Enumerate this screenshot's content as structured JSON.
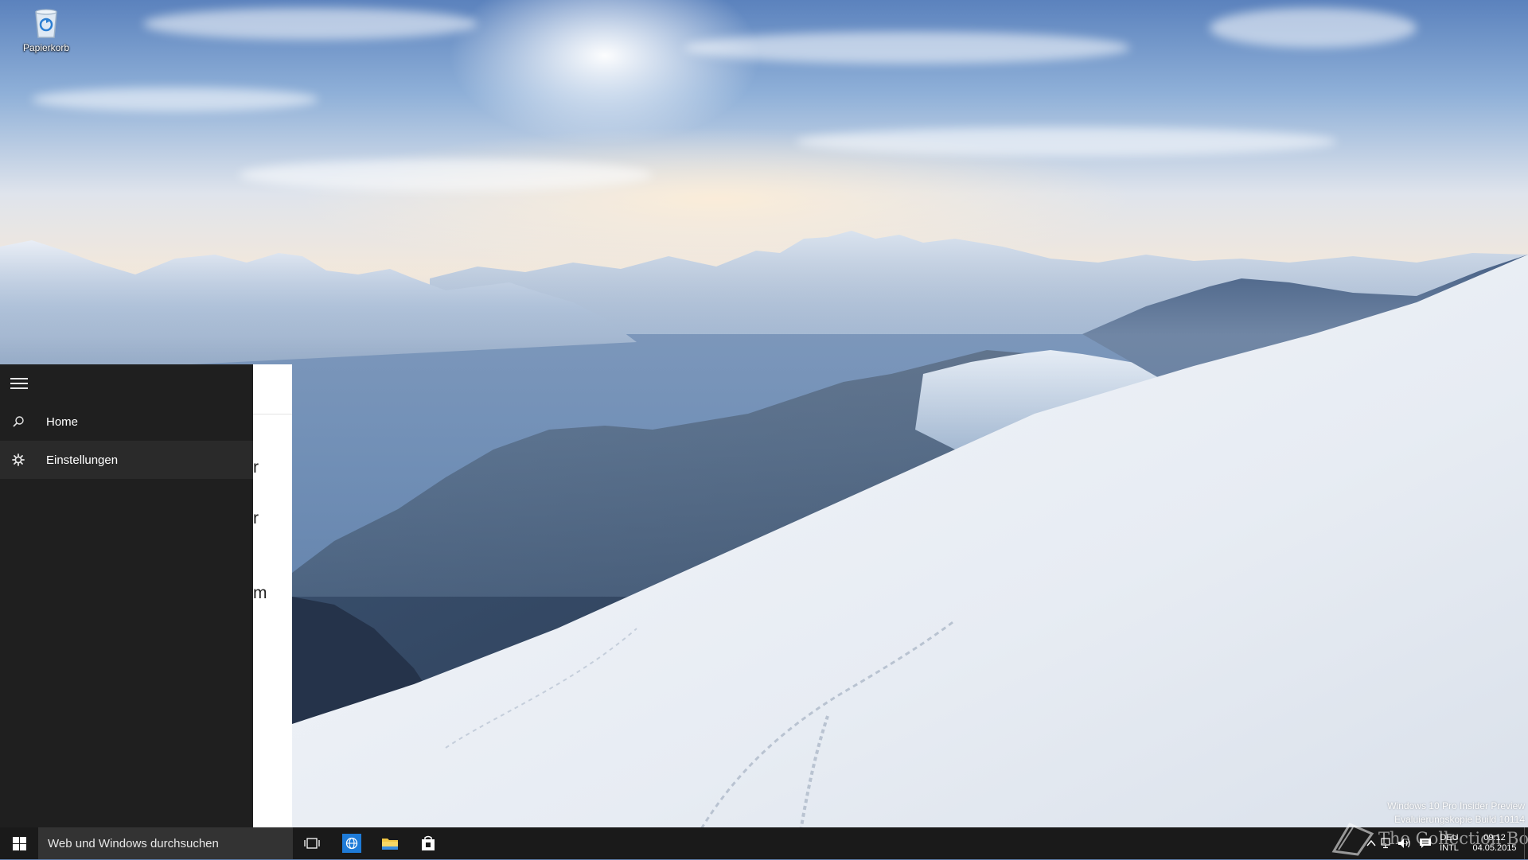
{
  "desktop": {
    "icons": [
      {
        "label": "Papierkorb",
        "icon": "recycle-bin-icon"
      }
    ],
    "watermark": {
      "build_line1": "Windows 10 Pro Insider Preview",
      "build_line2": "Evaluierungskopie Build 10114",
      "brand": "The Collection Book"
    }
  },
  "start_menu": {
    "hamburger_icon": "hamburger-icon",
    "items": [
      {
        "label": "Home",
        "icon": "search-icon"
      },
      {
        "label": "Einstellungen",
        "icon": "gear-icon",
        "selected": true
      }
    ],
    "clipped_text": [
      "r",
      "r",
      "m"
    ]
  },
  "taskbar": {
    "start_icon": "windows-logo-icon",
    "search_placeholder": "Web und Windows durchsuchen",
    "apps": [
      {
        "name": "task-view",
        "icon": "task-view-icon"
      },
      {
        "name": "edge-browser",
        "icon": "edge-browser-icon",
        "color": "#1e7bd8"
      },
      {
        "name": "file-explorer",
        "icon": "folder-icon",
        "color": "#f2c744"
      },
      {
        "name": "store",
        "icon": "store-icon"
      }
    ],
    "tray": {
      "language_top": "DEU",
      "language_bottom": "INTL",
      "time": "09:12",
      "date": "04.05.2015",
      "icons": [
        "up-arrow-icon",
        "network-icon",
        "volume-icon",
        "notification-icon"
      ]
    }
  },
  "colors": {
    "taskbar_bg": "#1a1a1a",
    "start_bg": "#1f1f1f",
    "search_bg": "#333333",
    "accent": "#1e7bd8"
  }
}
